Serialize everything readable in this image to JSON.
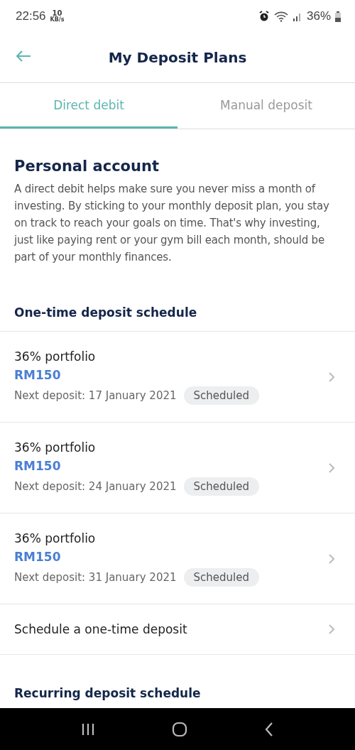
{
  "status_bar": {
    "time": "22:56",
    "speed_value": "10",
    "speed_unit": "KB/s",
    "battery": "36%"
  },
  "header": {
    "title": "My Deposit Plans"
  },
  "tabs": [
    {
      "label": "Direct debit",
      "selected": true
    },
    {
      "label": "Manual deposit",
      "selected": false
    }
  ],
  "account": {
    "title": "Personal account",
    "description": "A direct debit helps make sure you never miss a month of investing. By sticking to your monthly deposit plan, you stay on track to reach your goals on time. That's why investing, just like paying rent or your gym bill each month, should be part of your monthly finances."
  },
  "one_time": {
    "title": "One-time deposit schedule",
    "deposits": [
      {
        "portfolio": "36% portfolio",
        "amount": "RM150",
        "next": "Next deposit: 17 January 2021",
        "status": "Scheduled"
      },
      {
        "portfolio": "36% portfolio",
        "amount": "RM150",
        "next": "Next deposit: 24 January 2021",
        "status": "Scheduled"
      },
      {
        "portfolio": "36% portfolio",
        "amount": "RM150",
        "next": "Next deposit: 31 January 2021",
        "status": "Scheduled"
      }
    ],
    "action": "Schedule a one-time deposit"
  },
  "recurring": {
    "title": "Recurring deposit schedule"
  }
}
